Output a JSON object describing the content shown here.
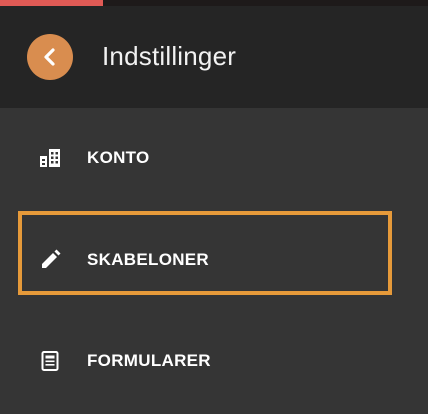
{
  "header": {
    "title": "Indstillinger",
    "back_icon": "chevron-left-icon",
    "back_button_color": "#d98d4f"
  },
  "menu": {
    "items": [
      {
        "label": "KONTO",
        "icon": "building-icon"
      },
      {
        "label": "SKABELONER",
        "icon": "pencil-icon",
        "highlighted": true
      },
      {
        "label": "FORMULARER",
        "icon": "document-icon"
      }
    ]
  },
  "colors": {
    "background": "#353535",
    "header_background": "#252525",
    "top_accent": "#e05a55",
    "highlight_border": "#e69a3a",
    "text": "#ffffff"
  }
}
